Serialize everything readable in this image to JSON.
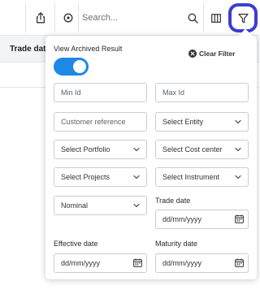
{
  "toolbar": {
    "search_placeholder": "Search..."
  },
  "table": {
    "column_header": "Trade date"
  },
  "filter_panel": {
    "archived_label": "View Archived Result",
    "archived_on": true,
    "clear_filter_label": "Clear Filter",
    "min_id_placeholder": "Min Id",
    "max_id_placeholder": "Max Id",
    "customer_reference_placeholder": "Customer reference",
    "entity_select": "Select Entity",
    "portfolio_select": "Select Portfolio",
    "cost_center_select": "Select Cost center",
    "projects_select": "Select Projects",
    "instrument_select": "Select Instrument",
    "nominal_select": "Nominal",
    "trade_date_label": "Trade date",
    "trade_date_placeholder": "dd/mm/yyyy",
    "effective_date_label": "Effective date",
    "effective_date_placeholder": "dd/mm/yyyy",
    "maturity_date_label": "Maturity date",
    "maturity_date_placeholder": "dd/mm/yyyy"
  },
  "colors": {
    "accent": "#1e88e5",
    "highlight": "#3d3dd1",
    "border": "#c9cdd2"
  },
  "icons": [
    "share-icon",
    "settings-icon",
    "search-icon",
    "columns-icon",
    "filter-icon",
    "close-circle-icon",
    "chevron-down-icon",
    "calendar-icon"
  ]
}
